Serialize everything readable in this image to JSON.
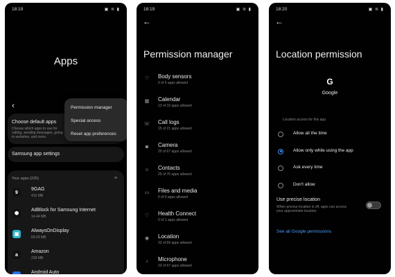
{
  "screen1": {
    "time": "18:19",
    "status_icons": "▣ ≋ ▮",
    "title": "Apps",
    "default_apps": {
      "title": "Choose default apps",
      "desc": "Choose which apps to use for calling, sending messages, going to websites, and more."
    },
    "samsung_settings": "Samsung app settings",
    "list_header": "Your apps (225)",
    "menu": [
      "Permission manager",
      "Special access",
      "Reset app preferences"
    ],
    "apps": [
      {
        "name": "9GAG",
        "size": "415 MB",
        "icon": "9gag-icon",
        "glyph": "9",
        "bg": "#111111",
        "fg": "#ffffff"
      },
      {
        "name": "AdBlock for Samsung Internet",
        "size": "14.44 MB",
        "icon": "adblock-icon",
        "glyph": "⬢",
        "bg": "#111111",
        "fg": "#ffffff"
      },
      {
        "name": "AlwaysOnDisplay",
        "size": "69.03 MB",
        "icon": "aod-icon",
        "glyph": "▣",
        "bg": "#2bb5c9",
        "fg": "#ffffff"
      },
      {
        "name": "Amazon",
        "size": "228 MB",
        "icon": "amazon-icon",
        "glyph": "a",
        "bg": "#111111",
        "fg": "#ffffff"
      },
      {
        "name": "Android Auto",
        "size": "",
        "icon": "android-auto-icon",
        "glyph": "▲",
        "bg": "#2a6ef0",
        "fg": "#ffffff"
      }
    ]
  },
  "screen2": {
    "time": "18:19",
    "status_icons": "▣ ≋ ▮",
    "title": "Permission manager",
    "permissions": [
      {
        "name": "Body sensors",
        "sub": "0 of 5 apps allowed",
        "icon": "heart-icon",
        "glyph": "♡"
      },
      {
        "name": "Calendar",
        "sub": "13 of 19 apps allowed",
        "icon": "calendar-icon",
        "glyph": "▦"
      },
      {
        "name": "Call logs",
        "sub": "15 of 21 apps allowed",
        "icon": "call-log-icon",
        "glyph": "☏"
      },
      {
        "name": "Camera",
        "sub": "20 of 67 apps allowed",
        "icon": "camera-icon",
        "glyph": "◙"
      },
      {
        "name": "Contacts",
        "sub": "25 of 76 apps allowed",
        "icon": "contacts-icon",
        "glyph": "☺"
      },
      {
        "name": "Files and media",
        "sub": "0 of 0 apps allowed",
        "icon": "folder-icon",
        "glyph": "▭"
      },
      {
        "name": "Health Connect",
        "sub": "0 of 1 apps allowed",
        "icon": "health-icon",
        "glyph": "♡"
      },
      {
        "name": "Location",
        "sub": "33 of 69 apps allowed",
        "icon": "location-icon",
        "glyph": "◉"
      },
      {
        "name": "Microphone",
        "sub": "23 of 67 apps allowed",
        "icon": "microphone-icon",
        "glyph": "♪"
      }
    ]
  },
  "screen3": {
    "time": "18:20",
    "status_icons": "▣ ≋ ▮",
    "title": "Location permission",
    "app_logo": "G",
    "app_name": "Google",
    "section_label": "Location access for this app",
    "options": [
      {
        "label": "Allow all the time",
        "selected": false
      },
      {
        "label": "Allow only while using the app",
        "selected": true
      },
      {
        "label": "Ask every time",
        "selected": false
      },
      {
        "label": "Don't allow",
        "selected": false
      }
    ],
    "precise": {
      "title": "Use precise location",
      "desc": "When precise location is off, apps can access your approximate location.",
      "enabled": false
    },
    "link": "See all Google permissions",
    "accent": "#3e8ef7"
  }
}
